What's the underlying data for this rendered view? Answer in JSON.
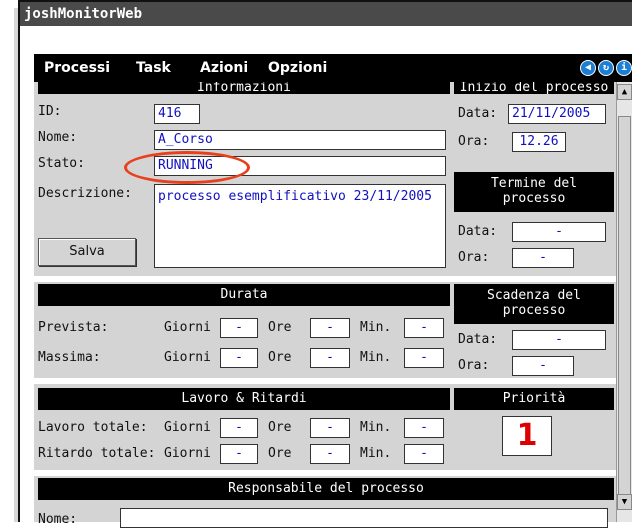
{
  "window": {
    "title": "joshMonitorWeb"
  },
  "menu": [
    {
      "label": "Processi"
    },
    {
      "label": "Task"
    },
    {
      "label": "Azioni"
    },
    {
      "label": "Opzioni"
    }
  ],
  "toolbar_icons": [
    "back-icon",
    "refresh-icon",
    "info-icon"
  ],
  "informazioni": {
    "header": "Informazioni",
    "id_label": "ID:",
    "id_value": "416",
    "nome_label": "Nome:",
    "nome_value": "A_Corso",
    "stato_label": "Stato:",
    "stato_value": "RUNNING",
    "descrizione_label": "Descrizione:",
    "descrizione_value": "processo esemplificativo 23/11/2005",
    "salva_label": "Salva"
  },
  "inizio": {
    "header": "Inizio del processo",
    "data_label": "Data:",
    "data_value": "21/11/2005",
    "ora_label": "Ora:",
    "ora_value": "12.26"
  },
  "termine": {
    "header_line1": "Termine del",
    "header_line2": "processo",
    "data_label": "Data:",
    "data_value": "-",
    "ora_label": "Ora:",
    "ora_value": "-"
  },
  "durata": {
    "header": "Durata",
    "rows": [
      {
        "label": "Prevista:",
        "giorni_label": "Giorni",
        "giorni": "-",
        "ore_label": "Ore",
        "ore": "-",
        "min_label": "Min.",
        "min": "-"
      },
      {
        "label": "Massima:",
        "giorni_label": "Giorni",
        "giorni": "-",
        "ore_label": "Ore",
        "ore": "-",
        "min_label": "Min.",
        "min": "-"
      }
    ]
  },
  "scadenza": {
    "header_line1": "Scadenza del",
    "header_line2": "processo",
    "data_label": "Data:",
    "data_value": "-",
    "ora_label": "Ora:",
    "ora_value": "-"
  },
  "lavoro": {
    "header": "Lavoro & Ritardi",
    "rows": [
      {
        "label": "Lavoro totale:",
        "giorni_label": "Giorni",
        "giorni": "-",
        "ore_label": "Ore",
        "ore": "-",
        "min_label": "Min.",
        "min": "-"
      },
      {
        "label": "Ritardo totale:",
        "giorni_label": "Giorni",
        "giorni": "-",
        "ore_label": "Ore",
        "ore": "-",
        "min_label": "Min.",
        "min": "-"
      }
    ]
  },
  "priorita": {
    "header": "Priorità",
    "value": "1"
  },
  "responsabile": {
    "header": "Responsabile del processo",
    "nome_label": "Nome:",
    "nome_value": ""
  },
  "colors": {
    "menubar": "#000000",
    "panel": "#d4d4d4",
    "field_text": "#1010c0",
    "highlight": "#e8401c",
    "priority": "#dd0000"
  }
}
